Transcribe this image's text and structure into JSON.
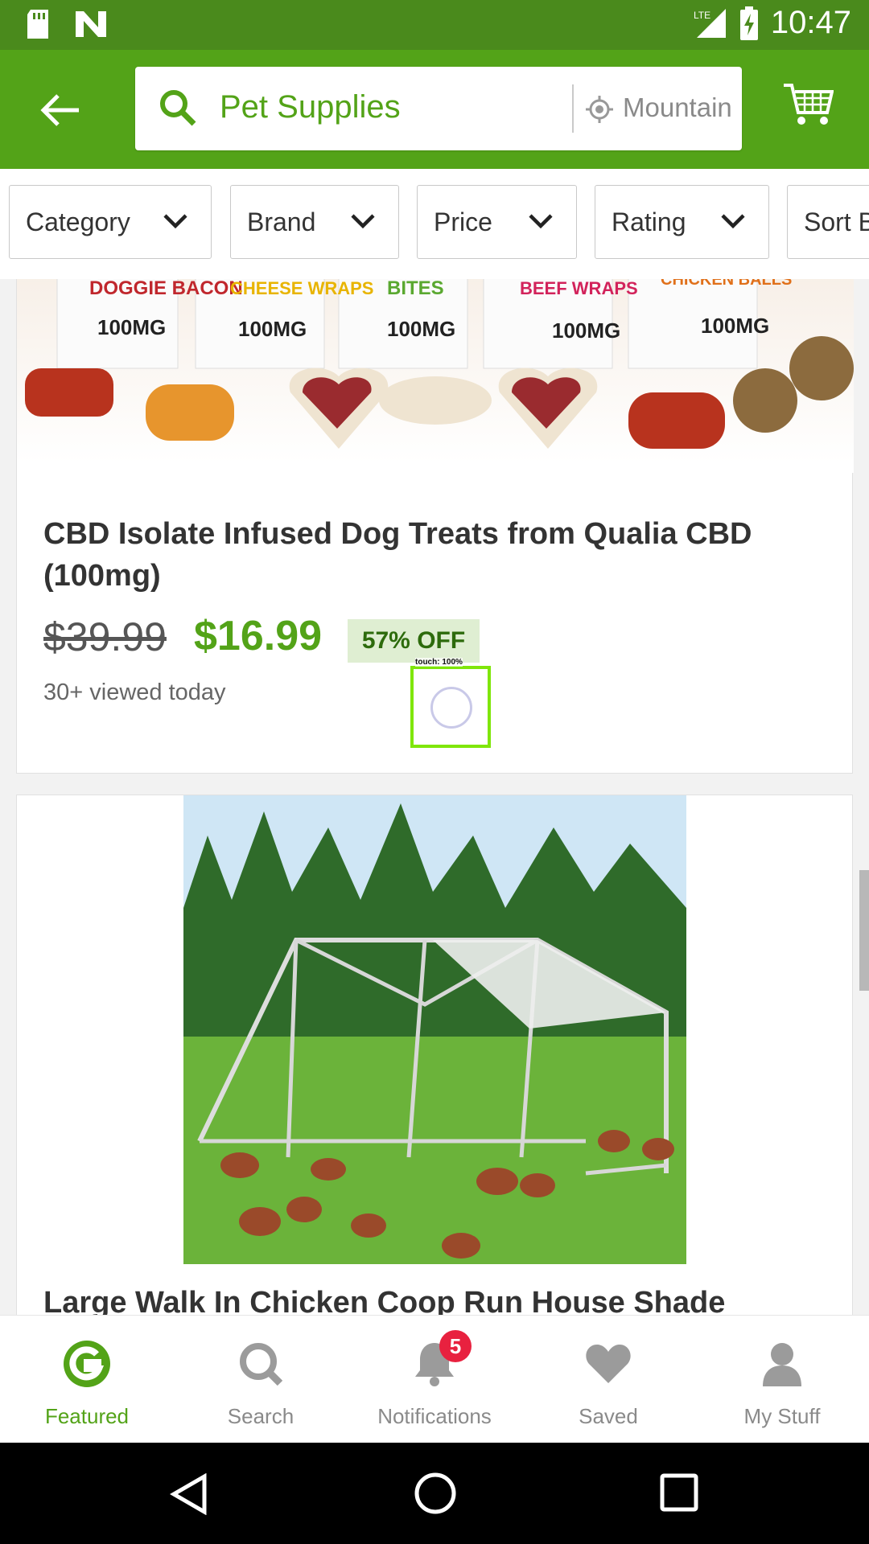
{
  "status_bar": {
    "time": "10:47",
    "network": "LTE",
    "icons": [
      "sd-card-icon",
      "n-logo-icon",
      "signal-icon",
      "battery-charging-icon"
    ]
  },
  "app_bar": {
    "search_query": "Pet Supplies",
    "location": "Mountain",
    "icons": [
      "back-arrow-icon",
      "search-icon",
      "location-icon",
      "cart-icon"
    ]
  },
  "filters": [
    "Category",
    "Brand",
    "Price",
    "Rating",
    "Sort B"
  ],
  "products": [
    {
      "image_labels": [
        "DOGGIE BACON",
        "CHEESE WRAPS",
        "BITES",
        "BEEF WRAPS",
        "CHICKEN BALLS"
      ],
      "image_dose": "100MG",
      "title": "CBD Isolate Infused Dog Treats from Qualia CBD (100mg)",
      "original_price": "$39.99",
      "price": "$16.99",
      "discount": "57% OFF",
      "views": "30+ viewed today"
    },
    {
      "title": "Large Walk In Chicken Coop Run House Shade"
    }
  ],
  "touch_indicator": {
    "label": "touch: 100%"
  },
  "bottom_nav": [
    {
      "label": "Featured",
      "icon": "featured-g-icon",
      "active": true
    },
    {
      "label": "Search",
      "icon": "search-icon",
      "active": false
    },
    {
      "label": "Notifications",
      "icon": "bell-icon",
      "active": false,
      "badge": "5"
    },
    {
      "label": "Saved",
      "icon": "heart-icon",
      "active": false
    },
    {
      "label": "My Stuff",
      "icon": "person-icon",
      "active": false
    }
  ],
  "colors": {
    "brand_green": "#53a318",
    "status_green": "#4a8a1c",
    "badge_red": "#e8213f"
  }
}
